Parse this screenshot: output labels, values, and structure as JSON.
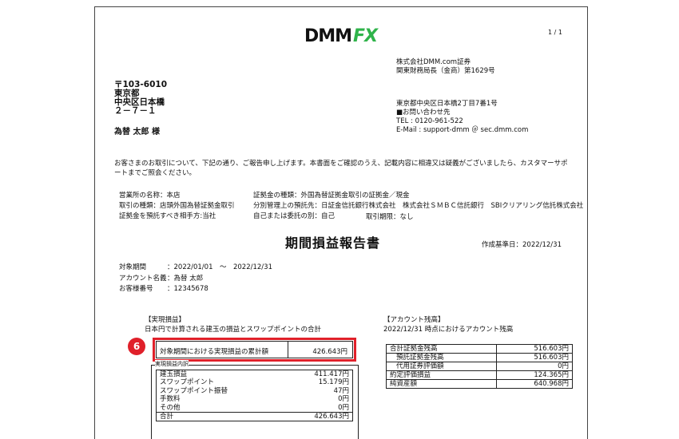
{
  "logo": {
    "dmm": "DMM",
    "fx": "FX"
  },
  "page_number": "1 / 1",
  "company": [
    "株式会社DMM.com証券",
    "関東財務局長（金商）第1629号"
  ],
  "contact": [
    "東京都中央区日本橋2丁目7番1号",
    "■お問い合わせ先",
    "TEL : 0120-961-522",
    "E-Mail : support-dmm ＠ sec.dmm.com"
  ],
  "address": [
    "〒103-6010",
    "東京都",
    "中央区日本橋",
    "２－７－１"
  ],
  "recipient": "為替 太郎 様",
  "intro": [
    "お客さまのお取引について、下記の通り、ご報告申し上げます。本書面をご確認のうえ、記載内容に相違又は疑義がございましたら、カスタマーサポ",
    "ートまでご照会ください。"
  ],
  "info_left": [
    "営業所の名称：本店",
    "取引の種類：店頭外国為替証拠金取引",
    "証拠金を預託すべき相手方:当社"
  ],
  "info_right": [
    "証拠金の種類：外国為替証拠金取引の証拠金／現金",
    "分別管理上の預託先：日証金信託銀行株式会社　株式会社ＳＭＢＣ信託銀行　SBIクリアリング信託株式会社",
    "自己または委託の別：自己"
  ],
  "period_type": "取引期限：なし",
  "title": "期間損益報告書",
  "base_date": "作成基準日：2022/12/31",
  "meta": [
    {
      "label": "対象期間",
      "value": "：2022/01/01　～　2022/12/31"
    },
    {
      "label": "アカウント名義",
      "value": "：為替 太郎"
    },
    {
      "label": "お客様番号",
      "value": "：12345678"
    }
  ],
  "realized": {
    "heading": "【実現損益】",
    "subheading": "日本円で計算される建玉の損益とスワップポイントの合計",
    "cumulative_label": "対象期間における実現損益の累計額",
    "cumulative_value": "426.643円",
    "badge": "6",
    "detail_heading": "実現損益内訳",
    "rows": [
      {
        "label": "建玉損益",
        "value": "411.417円"
      },
      {
        "label": "スワップポイント",
        "value": "15.179円"
      },
      {
        "label": "スワップポイント振替",
        "value": "47円"
      },
      {
        "label": "手数料",
        "value": "0円"
      },
      {
        "label": "その他",
        "value": "0円"
      }
    ],
    "total_label": "合計",
    "total_value": "426.643円"
  },
  "account": {
    "heading": "【アカウント残高】",
    "subheading": "2022/12/31 時点におけるアカウント残高",
    "rows": [
      {
        "label": "合計証拠金残高",
        "value": "516.603円",
        "indent": false
      },
      {
        "label": "預託証拠金残高",
        "value": "516.603円",
        "indent": true
      },
      {
        "label": "代用証券評価額",
        "value": "0円",
        "indent": true
      },
      {
        "label": "約定評価損益",
        "value": "124.365円",
        "indent": false
      },
      {
        "label": "純資産額",
        "value": "640.968円",
        "indent": false
      }
    ]
  }
}
